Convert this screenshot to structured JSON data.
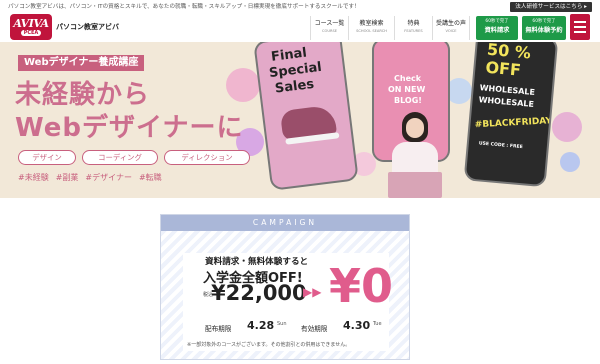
{
  "topbar": {
    "tagline": "パソコン教室アビバは、パソコン・ITの資格とスキルで、あなたの就職・転職・スキルアップ・日標実現を徹底サポートするスクールです！",
    "corporate_link": "法人研修サービスはこちら ▸"
  },
  "header": {
    "logo_main": "AVIVA",
    "logo_sub": "PCEA",
    "brand": "パソコン教室アビバ",
    "nav": [
      {
        "jp": "コース一覧",
        "en": "COURSE"
      },
      {
        "jp": "教室検索",
        "en": "SCHOOL SEARCH"
      },
      {
        "jp": "特典",
        "en": "FEATURES"
      },
      {
        "jp": "受講生の声",
        "en": "VOICE"
      }
    ],
    "cta_request": {
      "small": "60秒で完了",
      "label": "資料請求"
    },
    "cta_trial": {
      "small": "60秒で完了",
      "label": "無料体験予約"
    }
  },
  "hero": {
    "badge": "Webデザイナー養成講座",
    "title_line1": "未経験から",
    "title_line2": "Webデザイナーに",
    "chips": [
      "デザイン",
      "コーディング",
      "ディレクション"
    ],
    "hashtags": [
      "#未経験",
      "#副業",
      "#デザイナー",
      "#転職"
    ],
    "phone1_line1": "Final",
    "phone1_line2": "Special",
    "phone1_line3": "Sales",
    "phone2_line1": "Check",
    "phone2_line2": "ON NEW",
    "phone2_line3": "BLOG!",
    "phone3_line1": "50 %",
    "phone3_line2": "OFF",
    "phone3_line3": "WHOLESALE",
    "phone3_line4": "WHOLESALE",
    "phone3_line5": "#BLACKFRIDAY",
    "phone3_line6": "USE CODE : FREE"
  },
  "campaign": {
    "heading": "CAMPAIGN",
    "line1": "資料請求・無料体験すると",
    "line2": "入学金全額OFF!",
    "tax_label": "税込",
    "price_before": "¥22,000",
    "price_after": "¥0",
    "period_label": "配布期限",
    "period_value": "4.28",
    "period_day": "Sun",
    "valid_label": "有効期限",
    "valid_value": "4.30",
    "valid_day": "Tue",
    "note": "※一部対象外のコースがございます。その他割引との併用はできません。"
  },
  "colors": {
    "brand_red": "#c0143c",
    "cta_green": "#1e9a48",
    "hero_pink": "#cc6e8e",
    "hero_bg": "#f2e8d8",
    "campaign_blue": "#aab7d8",
    "campaign_pink": "#e05c8c"
  },
  "icons": [
    "menu-icon",
    "arrow-right-icon"
  ]
}
